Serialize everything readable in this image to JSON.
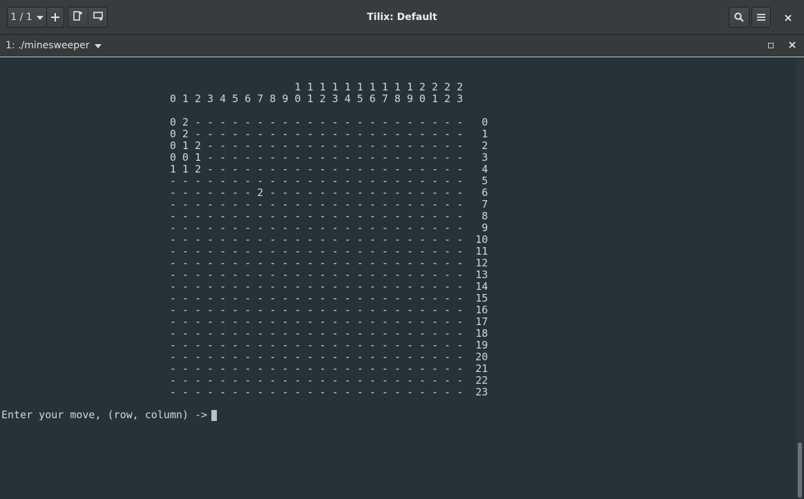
{
  "headerbar": {
    "title": "Tilix: Default",
    "session_switcher": "1 / 1",
    "icons": {
      "dropdown": "chevron-down-icon",
      "add": "plus-icon",
      "add_right": "split-right-icon",
      "add_down": "split-down-icon",
      "search": "search-icon",
      "menu": "hamburger-menu-icon",
      "close": "close-icon"
    }
  },
  "session": {
    "title": "1: ./minesweeper",
    "icons": {
      "dropdown": "chevron-down-icon",
      "maximize": "maximize-icon",
      "close": "close-icon"
    }
  },
  "terminal": {
    "board_lines": [
      "                                               1 1 1 1 1 1 1 1 1 1 2 2 2 2",
      "                           0 1 2 3 4 5 6 7 8 9 0 1 2 3 4 5 6 7 8 9 0 1 2 3",
      "",
      "                           0 2 - - - - - - - - - - - - - - - - - - - - - -   0",
      "                           0 2 - - - - - - - - - - - - - - - - - - - - - -   1",
      "                           0 1 2 - - - - - - - - - - - - - - - - - - - - -   2",
      "                           0 0 1 - - - - - - - - - - - - - - - - - - - - -   3",
      "                           1 1 2 - - - - - - - - - - - - - - - - - - - - -   4",
      "                           - - - - - - - - - - - - - - - - - - - - - - - -   5",
      "                           - - - - - - - 2 - - - - - - - - - - - - - - - -   6",
      "                           - - - - - - - - - - - - - - - - - - - - - - - -   7",
      "                           - - - - - - - - - - - - - - - - - - - - - - - -   8",
      "                           - - - - - - - - - - - - - - - - - - - - - - - -   9",
      "                           - - - - - - - - - - - - - - - - - - - - - - - -  10",
      "                           - - - - - - - - - - - - - - - - - - - - - - - -  11",
      "                           - - - - - - - - - - - - - - - - - - - - - - - -  12",
      "                           - - - - - - - - - - - - - - - - - - - - - - - -  13",
      "                           - - - - - - - - - - - - - - - - - - - - - - - -  14",
      "                           - - - - - - - - - - - - - - - - - - - - - - - -  15",
      "                           - - - - - - - - - - - - - - - - - - - - - - - -  16",
      "                           - - - - - - - - - - - - - - - - - - - - - - - -  17",
      "                           - - - - - - - - - - - - - - - - - - - - - - - -  18",
      "                           - - - - - - - - - - - - - - - - - - - - - - - -  19",
      "                           - - - - - - - - - - - - - - - - - - - - - - - -  20",
      "                           - - - - - - - - - - - - - - - - - - - - - - - -  21",
      "                           - - - - - - - - - - - - - - - - - - - - - - - -  22",
      "                           - - - - - - - - - - - - - - - - - - - - - - - -  23"
    ],
    "prompt": "Enter your move, (row, column) ->"
  },
  "colors": {
    "terminal_bg": "#263238",
    "terminal_fg": "#cfd8dc",
    "headerbar_bg": "#383c3e"
  }
}
